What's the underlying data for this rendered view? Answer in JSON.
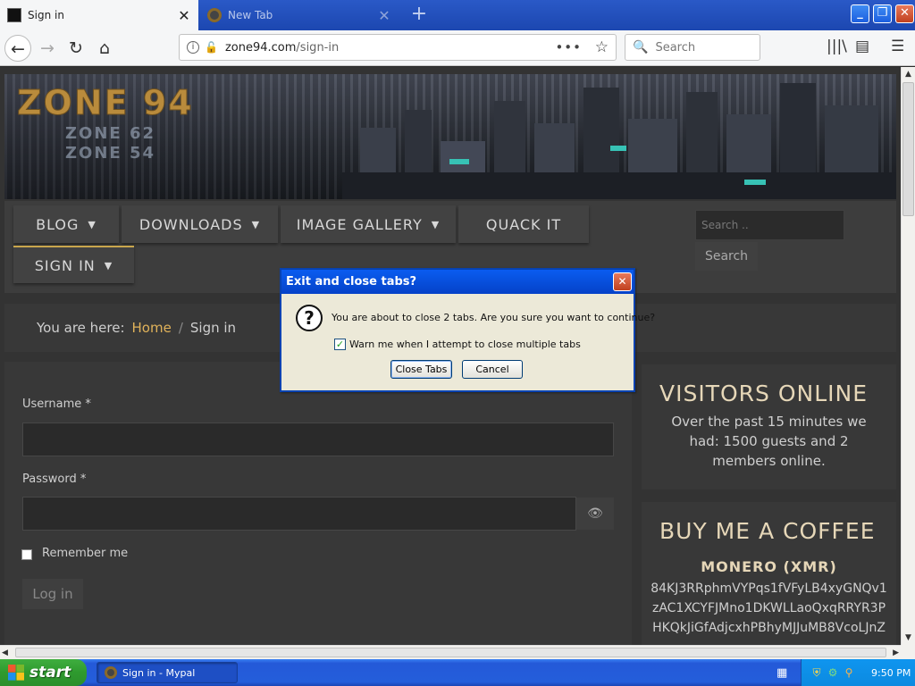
{
  "browser": {
    "tabs": [
      {
        "title": "Sign in",
        "active": true
      },
      {
        "title": "New Tab",
        "active": false
      }
    ],
    "url_host": "zone94.com",
    "url_path": "/sign-in",
    "search_placeholder": "Search"
  },
  "site": {
    "logo": "ZONE 94",
    "logo_sub_1": "ZONE 62",
    "logo_sub_2": "ZONE 54",
    "menu": [
      {
        "label": "BLOG",
        "has_dropdown": true
      },
      {
        "label": "DOWNLOADS",
        "has_dropdown": true
      },
      {
        "label": "IMAGE GALLERY",
        "has_dropdown": true
      },
      {
        "label": "QUACK IT",
        "has_dropdown": false
      },
      {
        "label": "SIGN IN",
        "has_dropdown": true
      }
    ],
    "search_placeholder": "Search ..",
    "search_button": "Search",
    "breadcrumb": {
      "prefix": "You are here:",
      "home": "Home",
      "separator": "/",
      "current": "Sign in"
    },
    "login": {
      "username_label": "Username *",
      "password_label": "Password *",
      "remember_label": "Remember me",
      "submit_label": "Log in"
    },
    "visitors": {
      "title": "VISITORS ONLINE",
      "text": "Over the past 15 minutes we had: 1500 guests and 2 members online."
    },
    "coffee": {
      "title": "BUY ME A COFFEE",
      "subtitle": "MONERO (XMR)",
      "wallet_lines": [
        "84KJ3RRphmVYPqs1fVFyLB4xyGNQv1",
        "zAC1XCYFJMno1DKWLLaoQxqRRYR3P",
        "HKQkJiGfAdjcxhPBhyMJJuMB8VcoLJnZ"
      ]
    }
  },
  "dialog": {
    "title": "Exit and close tabs?",
    "message": "You are about to close 2 tabs. Are you sure you want to continue?",
    "checkbox_label": "Warn me when I attempt to close multiple tabs",
    "checkbox_checked": true,
    "confirm_label": "Close Tabs",
    "cancel_label": "Cancel"
  },
  "taskbar": {
    "start_label": "start",
    "task_label": "Sign in - Mypal",
    "clock": "9:50 PM"
  }
}
